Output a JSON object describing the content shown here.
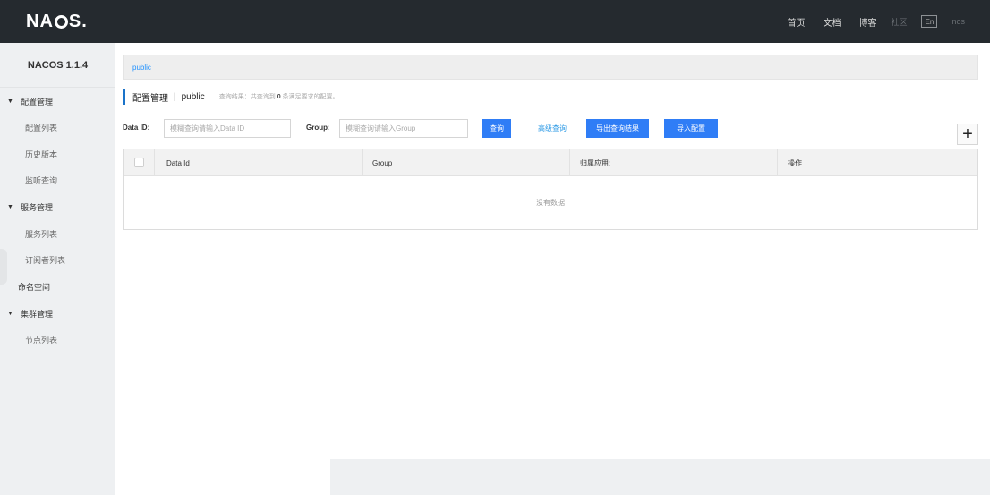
{
  "topbar": {
    "logo": {
      "left": "NA",
      "right": "S."
    },
    "nav": [
      {
        "label": "首页"
      },
      {
        "label": "文档"
      },
      {
        "label": "博客"
      }
    ],
    "faint_links": [
      "社区",
      "nos"
    ],
    "lang_button": "En"
  },
  "sidebar": {
    "version": "NACOS 1.1.4",
    "groups": [
      {
        "label": "配置管理",
        "items": [
          "配置列表",
          "历史版本",
          "监听查询"
        ]
      },
      {
        "label": "服务管理",
        "items": [
          "服务列表",
          "订阅者列表"
        ]
      }
    ],
    "namespace": "命名空间",
    "cluster": {
      "label": "集群管理",
      "items": [
        "节点列表"
      ]
    }
  },
  "breadcrumb": {
    "namespace": "public"
  },
  "page_header": {
    "title": "配置管理",
    "separator": "|",
    "namespace": "public",
    "result_prefix": "查询结果：共查询到",
    "result_count": "0",
    "result_suffix": "条满足要求的配置。"
  },
  "filters": {
    "data_id_label": "Data ID:",
    "data_id_placeholder": "模糊查询请输入Data ID",
    "group_label": "Group:",
    "group_placeholder": "模糊查询请输入Group",
    "query_button": "查询",
    "advanced_link": "高级查询",
    "export_button": "导出查询结果",
    "import_button": "导入配置",
    "add_button": "+"
  },
  "table": {
    "columns": [
      "Data Id",
      "Group",
      "归属应用:",
      "操作"
    ],
    "empty_text": "没有数据"
  },
  "colors": {
    "topbar_bg": "#252a2f",
    "sidebar_bg": "#eef0f2",
    "primary": "#2f7df6",
    "link": "#2f9be6",
    "accent_bar": "#1a73c9"
  }
}
